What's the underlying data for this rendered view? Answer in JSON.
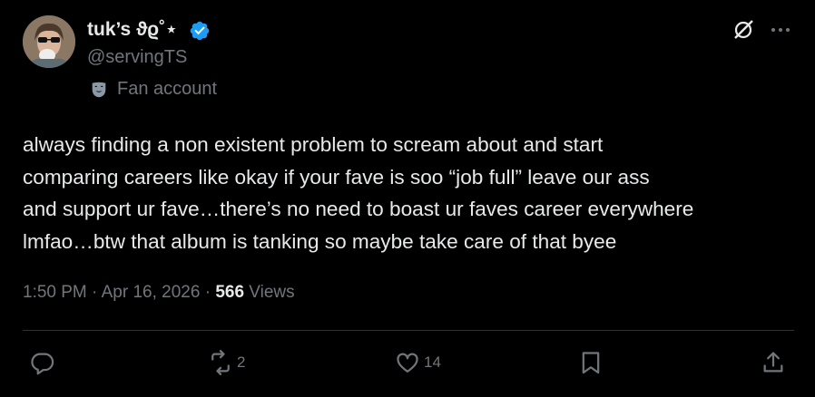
{
  "author": {
    "display_name": "tuk’s ϑϱ˚⋆",
    "handle": "@servingTS",
    "label": "Fan account"
  },
  "post": {
    "text_lines": [
      "always finding a non existent problem to scream about and start",
      "comparing careers like okay if your fave is soo “job full” leave our ass",
      "and support ur fave…there’s no need to boast ur faves career everywhere",
      "lmfao…btw that album is tanking so maybe take care of that byee"
    ],
    "time": "1:50 PM",
    "sep1": "·",
    "date": "Apr 16, 2026",
    "sep2": "·",
    "views_count": "566",
    "views_label": "Views"
  },
  "actions": {
    "reply_count": "",
    "repost_count": "2",
    "like_count": "14"
  },
  "colors": {
    "background": "#000000",
    "text": "#e7e9ea",
    "secondary": "#71767b",
    "verified": "#1d9bf0",
    "divider": "#2f3336"
  },
  "icons": [
    "grok-icon",
    "more-icon",
    "verified-badge-icon",
    "fan-mask-icon",
    "reply-icon",
    "repost-icon",
    "like-icon",
    "bookmark-icon",
    "share-icon"
  ]
}
